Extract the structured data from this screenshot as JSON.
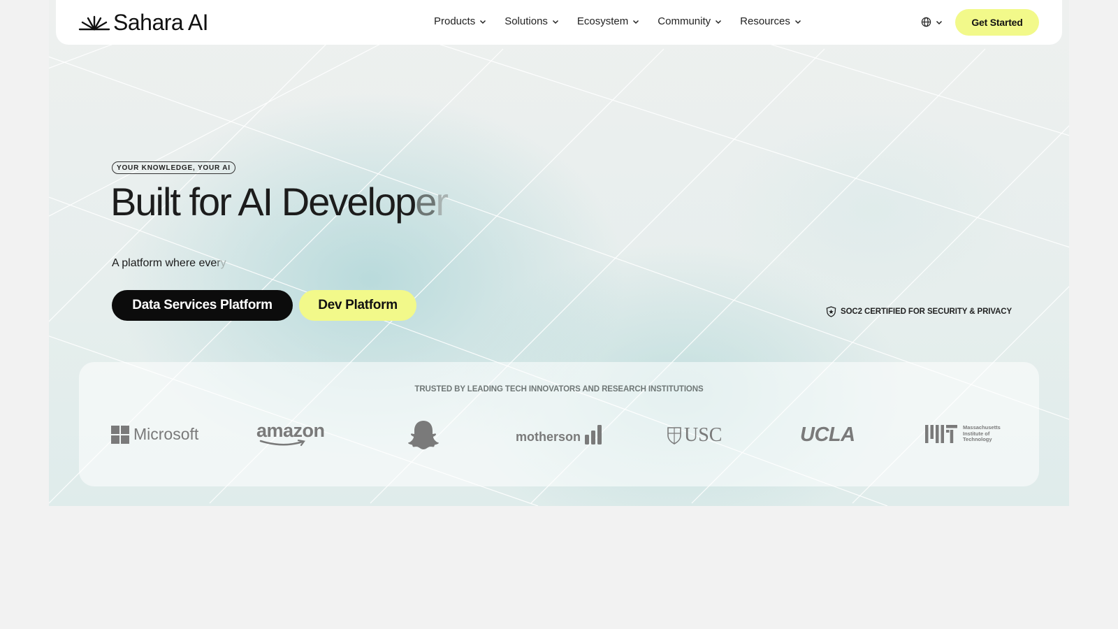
{
  "brand": {
    "name": "Sahara AI"
  },
  "nav": {
    "items": [
      {
        "label": "Products"
      },
      {
        "label": "Solutions"
      },
      {
        "label": "Ecosystem"
      },
      {
        "label": "Community"
      },
      {
        "label": "Resources"
      }
    ],
    "cta": "Get Started"
  },
  "hero": {
    "tag": "YOUR KNOWLEDGE, YOUR AI",
    "headline_main": "Built for AI Develop",
    "headline_fade1": "e",
    "headline_fade2": "r",
    "subline_main": "A platform where eve",
    "subline_fade1": "r",
    "subline_fade2": "y",
    "primary_button": "Data Services Platform",
    "secondary_button": "Dev Platform",
    "certification": "SOC2 CERTIFIED FOR SECURITY & PRIVACY"
  },
  "trusted": {
    "title": "TRUSTED BY LEADING TECH INNOVATORS AND RESEARCH INSTITUTIONS",
    "logos": {
      "microsoft": "Microsoft",
      "amazon": "amazon",
      "motherson": "motherson",
      "usc": "USC",
      "ucla": "UCLA",
      "mit_line1": "Massachusetts",
      "mit_line2": "Institute of",
      "mit_line3": "Technology"
    }
  },
  "colors": {
    "accent_yellow": "#f2f98a",
    "dark_button": "#0c0c0c",
    "background": "#f2f2f2"
  }
}
